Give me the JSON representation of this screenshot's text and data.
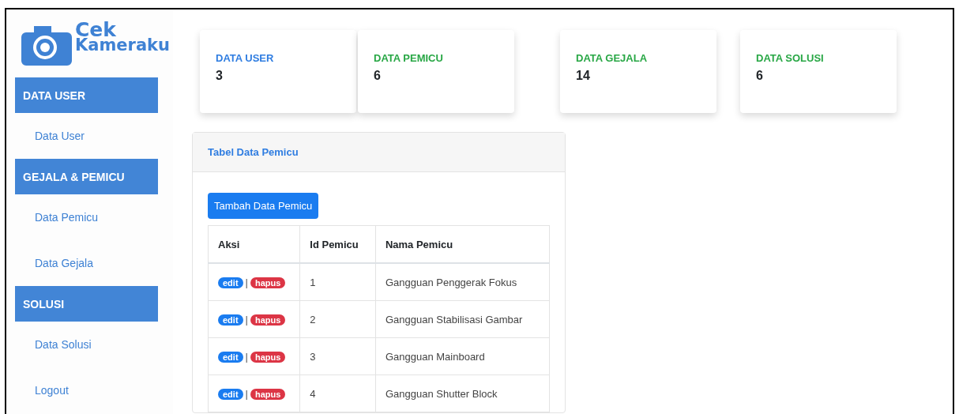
{
  "logo": {
    "line_1": "Cek",
    "line_2": "Kameraku"
  },
  "sidebar": {
    "items": [
      {
        "kind": "header",
        "label": "DATA USER"
      },
      {
        "kind": "link",
        "label": "Data User"
      },
      {
        "kind": "header",
        "label": "GEJALA & PEMICU"
      },
      {
        "kind": "link",
        "label": "Data Pemicu"
      },
      {
        "kind": "link",
        "label": "Data Gejala"
      },
      {
        "kind": "header",
        "label": "SOLUSI"
      },
      {
        "kind": "link",
        "label": "Data Solusi"
      },
      {
        "kind": "link",
        "label": "Logout"
      }
    ]
  },
  "stats": [
    {
      "label": "DATA USER",
      "value": "3",
      "color": "#2f7de1"
    },
    {
      "label": "DATA PEMICU",
      "value": "6",
      "color": "#28a745"
    },
    {
      "label": "DATA GEJALA",
      "value": "14",
      "color": "#28a745"
    },
    {
      "label": "DATA SOLUSI",
      "value": "6",
      "color": "#28a745"
    }
  ],
  "panel": {
    "title": "Tabel Data Pemicu",
    "add_button": "Tambah Data Pemicu",
    "table": {
      "columns": [
        "Aksi",
        "Id Pemicu",
        "Nama Pemicu"
      ],
      "rows": [
        {
          "edit": "edit",
          "separator": "|",
          "delete": "hapus",
          "id": "1",
          "name": "Gangguan Penggerak Fokus"
        },
        {
          "edit": "edit",
          "separator": "|",
          "delete": "hapus",
          "id": "2",
          "name": "Gangguan Stabilisasi Gambar"
        },
        {
          "edit": "edit",
          "separator": "|",
          "delete": "hapus",
          "id": "3",
          "name": "Gangguan Mainboard"
        },
        {
          "edit": "edit",
          "separator": "|",
          "delete": "hapus",
          "id": "4",
          "name": "Gangguan Shutter Block"
        }
      ]
    }
  }
}
